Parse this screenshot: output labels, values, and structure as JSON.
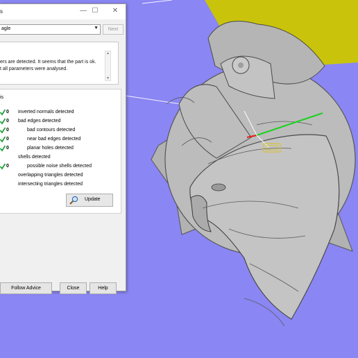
{
  "dialog": {
    "title": "s",
    "window_controls": [
      "—",
      "☐",
      "✕"
    ],
    "select_value": "agle",
    "next_label": "Next",
    "message_lines": [
      "ers are detected. It seems that the part is ok.",
      "t all parameters were analysed."
    ],
    "analysis_label": "is",
    "rows": [
      {
        "label": "inverted normals detected",
        "count": "0",
        "check": true
      },
      {
        "label": "bad edges detected",
        "count": "0",
        "check": true
      },
      {
        "label": "bad contours detected",
        "count": "0",
        "check": true
      },
      {
        "label": "near bad edges detected",
        "count": "0",
        "check": true
      },
      {
        "label": "planar holes detected",
        "count": "0",
        "check": true
      },
      {
        "label": "shells detected",
        "count": "",
        "check": false
      },
      {
        "label": "possible noise shells detected",
        "count": "0",
        "check": true
      },
      {
        "label": "overlapping triangles detected",
        "count": "",
        "check": false
      },
      {
        "label": "intersecting triangles detected",
        "count": "",
        "check": false
      }
    ],
    "update_label": "Update",
    "buttons": {
      "follow_advice": "Follow Advice",
      "close": "Close",
      "help": "Help"
    }
  },
  "colors": {
    "viewport_bg": "#8a86f3",
    "yellow_plane": "#c9c40b",
    "model_gray": "#b9b9b9",
    "check_green": "#1ea23c"
  }
}
